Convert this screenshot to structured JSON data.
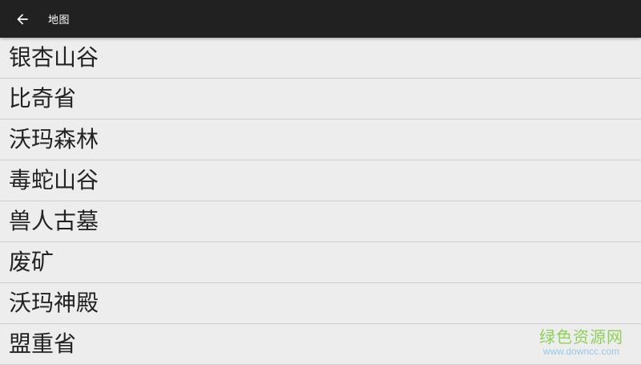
{
  "header": {
    "title": "地图",
    "back_icon": "arrow-back-icon",
    "background": "#212121"
  },
  "map_list": {
    "items": [
      {
        "label": "银杏山谷"
      },
      {
        "label": "比奇省"
      },
      {
        "label": "沃玛森林"
      },
      {
        "label": "毒蛇山谷"
      },
      {
        "label": "兽人古墓"
      },
      {
        "label": "废矿"
      },
      {
        "label": "沃玛神殿"
      },
      {
        "label": "盟重省"
      }
    ]
  },
  "watermark": {
    "title": "绿色资源网",
    "url": "www.downcc.com"
  }
}
